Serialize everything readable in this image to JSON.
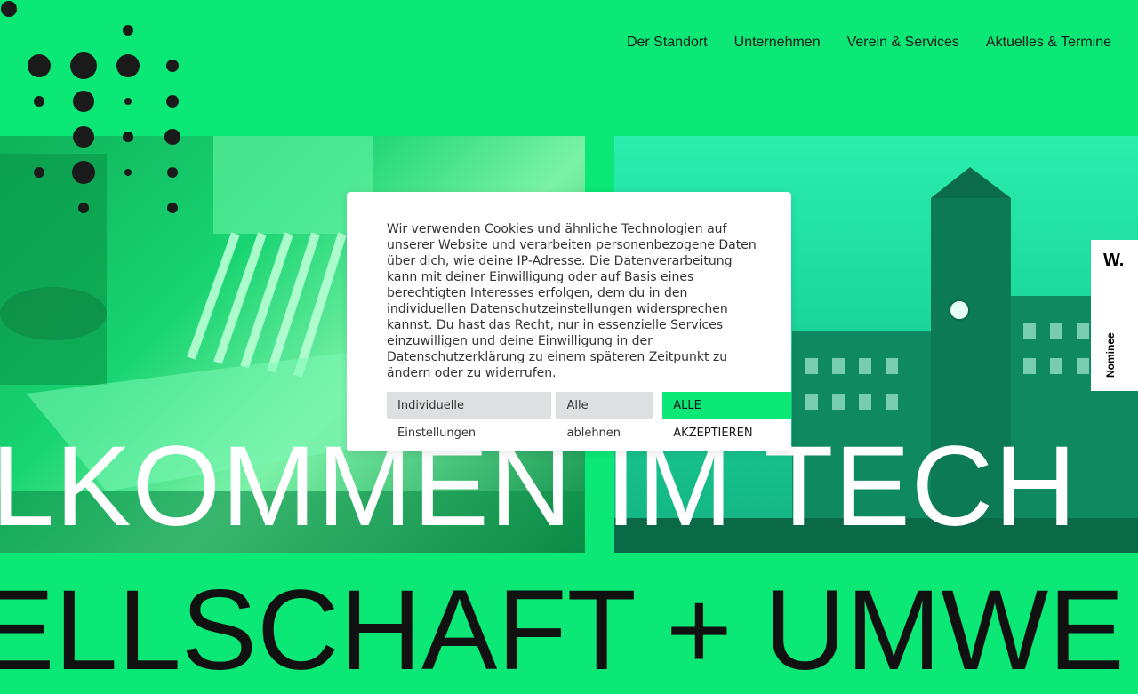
{
  "nav": {
    "items": [
      {
        "label": "Der Standort"
      },
      {
        "label": "Unternehmen"
      },
      {
        "label": "Verein & Services"
      },
      {
        "label": "Aktuelles & Termine"
      }
    ]
  },
  "hero": {
    "title": "LKOMMEN IM TECH",
    "subtitle": "ELLSCHAFT + UMWE"
  },
  "cookie": {
    "text": "Wir verwenden Cookies und ähnliche Technologien auf unserer Website und verarbeiten personenbezogene Daten über dich, wie deine IP-Adresse. Die Datenverarbeitung kann mit deiner Einwilligung oder auf Basis eines berechtigten Interesses erfolgen, dem du in den individuellen Datenschutzeinstellungen widersprechen kannst. Du hast das Recht, nur in essenzielle Services einzuwilligen und deine Einwilligung in der Datenschutzerklärung zu einem späteren Zeitpunkt zu ändern oder zu widerrufen.",
    "btn_individual": "Individuelle Einstellungen",
    "btn_reject": "Alle ablehnen",
    "btn_accept": "ALLE AKZEPTIEREN"
  },
  "badge": {
    "logo": "W.",
    "label": "Nominee"
  },
  "colors": {
    "brand_green": "#0be876",
    "text_dark": "#1a1a1a",
    "white": "#ffffff"
  }
}
